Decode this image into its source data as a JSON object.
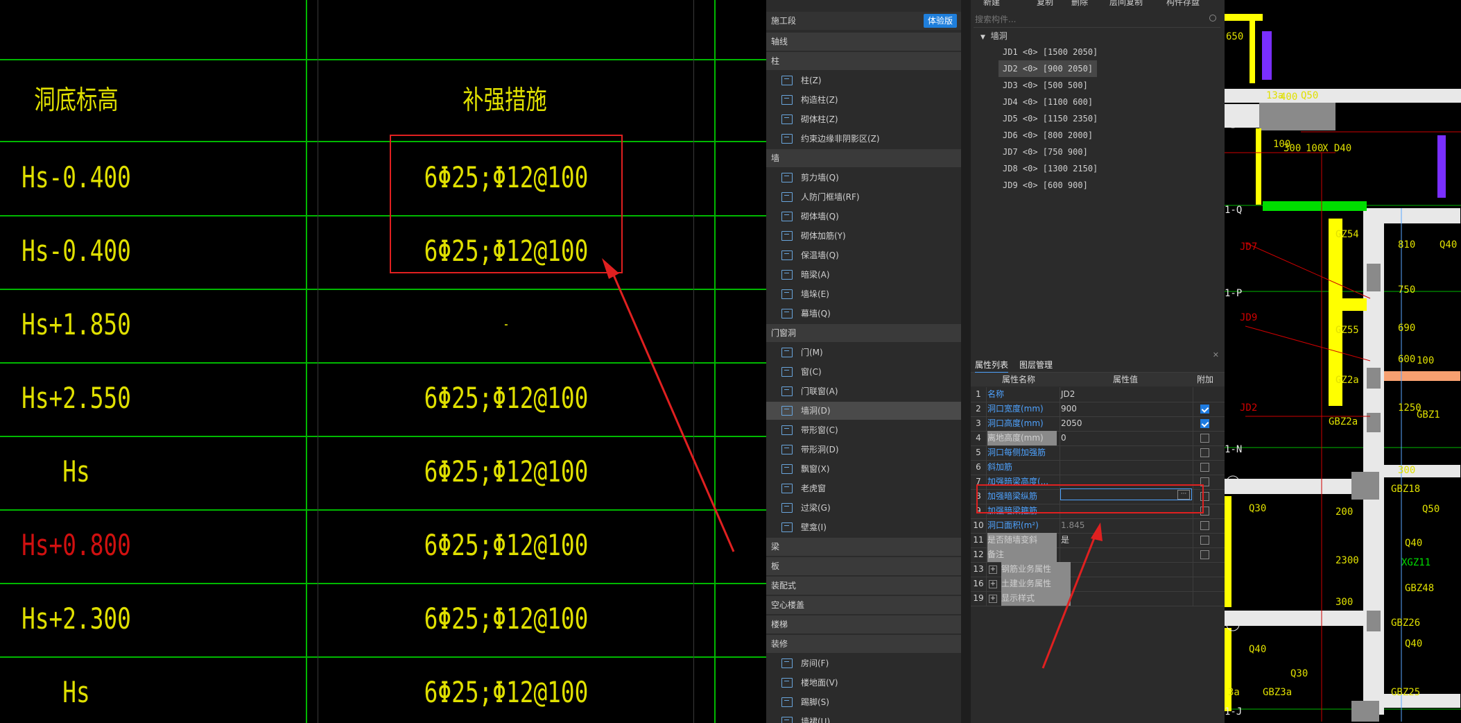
{
  "left_table": {
    "headers": [
      "洞底标高",
      "补强措施"
    ],
    "rows": [
      {
        "elevation": "Hs-0.400",
        "measure": "6Φ25;Φ12@100",
        "elev_color": "#e0e000"
      },
      {
        "elevation": "Hs-0.400",
        "measure": "6Φ25;Φ12@100",
        "elev_color": "#e0e000"
      },
      {
        "elevation": "Hs+1.850",
        "measure": "-",
        "elev_color": "#e0e000"
      },
      {
        "elevation": "Hs+2.550",
        "measure": "6Φ25;Φ12@100",
        "elev_color": "#e0e000"
      },
      {
        "elevation": "Hs",
        "measure": "6Φ25;Φ12@100",
        "elev_color": "#e0e000"
      },
      {
        "elevation": "Hs+0.800",
        "measure": "6Φ25;Φ12@100",
        "elev_color": "#d01010"
      },
      {
        "elevation": "Hs+2.300",
        "measure": "6Φ25;Φ12@100",
        "elev_color": "#e0e000"
      },
      {
        "elevation": "Hs",
        "measure": "6Φ25;Φ12@100",
        "elev_color": "#e0e000"
      }
    ]
  },
  "component_panel": {
    "top_label": "施工段",
    "badge": "体验版",
    "sections": [
      {
        "label": "轴线",
        "items": []
      },
      {
        "label": "柱",
        "items": [
          "柱(Z)",
          "构造柱(Z)",
          "砌体柱(Z)",
          "约束边缘非阴影区(Z)"
        ]
      },
      {
        "label": "墙",
        "items": [
          "剪力墙(Q)",
          "人防门框墙(RF)",
          "砌体墙(Q)",
          "砌体加筋(Y)",
          "保温墙(Q)",
          "暗梁(A)",
          "墙垛(E)",
          "幕墙(Q)"
        ]
      },
      {
        "label": "门窗洞",
        "items": [
          "门(M)",
          "窗(C)",
          "门联窗(A)",
          "墙洞(D)",
          "带形窗(C)",
          "带形洞(D)",
          "飘窗(X)",
          "老虎窗",
          "过梁(G)",
          "壁龛(I)"
        ]
      },
      {
        "label": "梁",
        "items": []
      },
      {
        "label": "板",
        "items": []
      },
      {
        "label": "装配式",
        "items": []
      },
      {
        "label": "空心楼盖",
        "items": []
      },
      {
        "label": "楼梯",
        "items": []
      },
      {
        "label": "装修",
        "items": [
          "房间(F)",
          "楼地面(V)",
          "踢脚(S)",
          "墙裙(U)"
        ]
      }
    ],
    "selected_item": "墙洞(D)"
  },
  "toolbar": {
    "new": "新建",
    "copy": "复制",
    "delete": "删除",
    "floor_copy": "层间复制",
    "save": "构件存盘"
  },
  "list_panel": {
    "search_placeholder": "搜索构件...",
    "group": "墙洞",
    "items": [
      "JD1 <0> [1500 2050]",
      "JD2 <0> [900 2050]",
      "JD3 <0> [500 500]",
      "JD4 <0> [1100 600]",
      "JD5 <0> [1150 2350]",
      "JD6 <0> [800 2000]",
      "JD7 <0> [750 900]",
      "JD8 <0> [1300 2150]",
      "JD9 <0> [600 900]"
    ],
    "selected": "JD2 <0> [900 2050]"
  },
  "properties": {
    "tabs": [
      "属性列表",
      "图层管理"
    ],
    "columns": [
      "属性名称",
      "属性值",
      "附加"
    ],
    "rows": [
      {
        "no": "1",
        "name": "名称",
        "value": "JD2",
        "blue": true,
        "cb": null
      },
      {
        "no": "2",
        "name": "洞口宽度(mm)",
        "value": "900",
        "blue": true,
        "cb": true
      },
      {
        "no": "3",
        "name": "洞口高度(mm)",
        "value": "2050",
        "blue": true,
        "cb": true
      },
      {
        "no": "4",
        "name": "离地高度(mm)",
        "value": "0",
        "blue": false,
        "cb": false
      },
      {
        "no": "5",
        "name": "洞口每侧加强筋",
        "value": "",
        "blue": true,
        "cb": false
      },
      {
        "no": "6",
        "name": "斜加筋",
        "value": "",
        "blue": true,
        "cb": false
      },
      {
        "no": "7",
        "name": "加强暗梁高度(...",
        "value": "",
        "blue": true,
        "cb": false
      },
      {
        "no": "8",
        "name": "加强暗梁纵筋",
        "value": "",
        "blue": true,
        "cb": false
      },
      {
        "no": "9",
        "name": "加强暗梁箍筋",
        "value": "",
        "blue": true,
        "cb": false
      },
      {
        "no": "10",
        "name": "洞口面积(m²)",
        "value": "1.845",
        "blue": true,
        "cb": false
      },
      {
        "no": "11",
        "name": "是否随墙变斜",
        "value": "是",
        "blue": false,
        "cb": false
      },
      {
        "no": "12",
        "name": "备注",
        "value": "",
        "blue": false,
        "cb": false
      },
      {
        "no": "13",
        "name": "钢筋业务属性",
        "value": "",
        "blue": false,
        "cb": null,
        "expand": true
      },
      {
        "no": "16",
        "name": "土建业务属性",
        "value": "",
        "blue": false,
        "cb": null,
        "expand": true
      },
      {
        "no": "19",
        "name": "显示样式",
        "value": "",
        "blue": false,
        "cb": null,
        "expand": true
      }
    ]
  },
  "cad_right": {
    "labels": [
      "650",
      "13a",
      "Q50",
      "400",
      "100",
      "300",
      "100",
      "X D40",
      "1-Q",
      "JD7",
      "GZ54",
      "810",
      "Q40",
      "750",
      "1-P",
      "JD9",
      "GZ55",
      "690",
      "600",
      "100",
      "GZ2a",
      "1250",
      "JD2",
      "GBZ2a",
      "GBZ1",
      "1-N",
      "300",
      "GBZ18",
      "Q50",
      "Q30",
      "200",
      "2300",
      "Q40",
      "XGZ11",
      "GBZ48",
      "300",
      "GBZ26",
      "Q40",
      "Q40",
      "Q30",
      "GBZ25",
      "3a",
      "GBZ3a",
      "1-J"
    ]
  }
}
